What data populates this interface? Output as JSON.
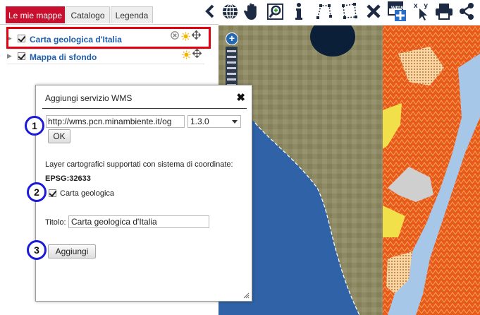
{
  "tabs": [
    {
      "label": "Le mie mappe",
      "active": true
    },
    {
      "label": "Catalogo",
      "active": false
    },
    {
      "label": "Legenda",
      "active": false
    }
  ],
  "layers": [
    {
      "name": "Carta geologica d'Italia",
      "checked": true
    },
    {
      "name": "Mappa di sfondo",
      "checked": true
    }
  ],
  "toolbar": {
    "icons": [
      "chevron-left-icon",
      "globe-icon",
      "pan-hand-icon",
      "zoom-box-icon",
      "info-icon",
      "measure-line-icon",
      "measure-area-icon",
      "clear-icon",
      "add-wms-icon",
      "coordinates-icon",
      "print-icon",
      "share-icon"
    ],
    "wms_label": "wms",
    "xy_label": "x y"
  },
  "dialog": {
    "title": "Aggiungi servizio WMS",
    "url_value": "http://wms.pcn.minambiente.it/og",
    "version_value": "1.3.0",
    "ok_label": "OK",
    "crs_text": "Layer cartografici supportati con sistema di coordinate:",
    "crs_code": "EPSG:32633",
    "layer_checkbox_label": "Carta geologica",
    "layer_checked": true,
    "title_label": "Titolo:",
    "title_value": "Carta geologica d'Italia",
    "add_label": "Aggiungi"
  },
  "step_markers": [
    "1",
    "2",
    "3"
  ],
  "colors": {
    "tab_active": "#c8102e",
    "highlight": "#e3000f",
    "layer_link": "#1f5fae",
    "marker_ring": "#1a1ad8",
    "toolbar_icon": "#1c2a44"
  }
}
